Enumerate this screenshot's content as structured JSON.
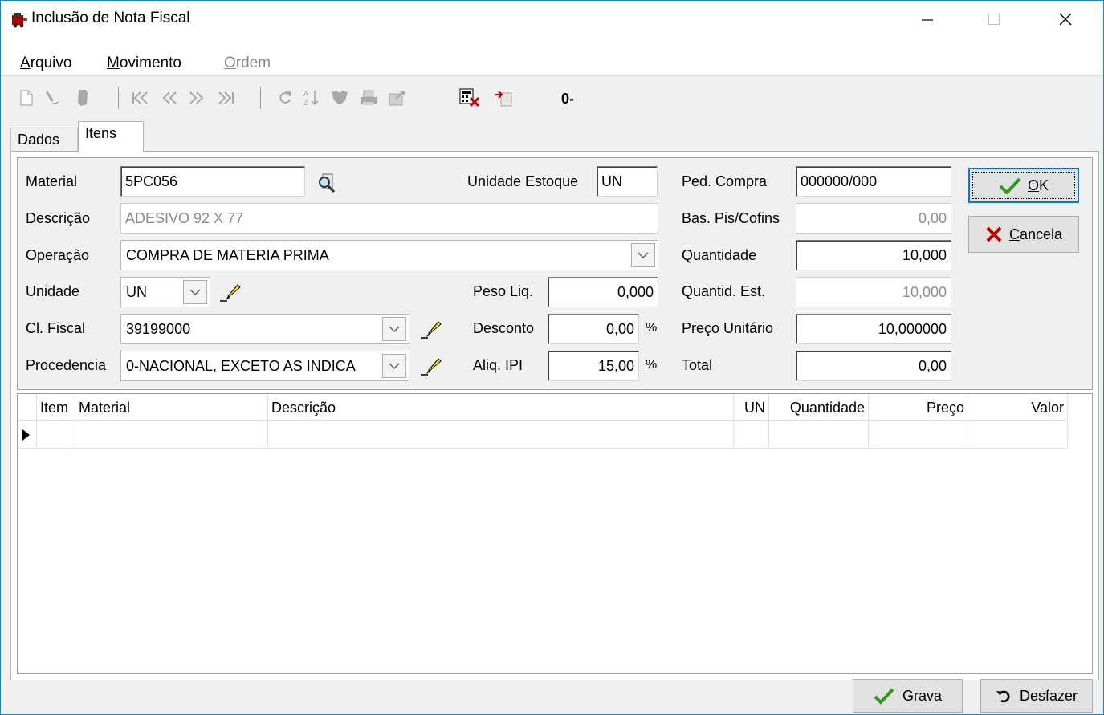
{
  "window": {
    "title": "Inclusão de Nota Fiscal",
    "controls": {
      "minimize": "—",
      "maximize": "☐",
      "close": "✕"
    }
  },
  "menu": {
    "items": [
      {
        "accel": "A",
        "rest": "rquivo",
        "enabled": true
      },
      {
        "accel": "M",
        "rest": "ovimento",
        "enabled": true
      },
      {
        "accel": "O",
        "rest": "rdem",
        "enabled": false
      }
    ]
  },
  "toolbar": {
    "record_counter": "0-",
    "icons": [
      "new-doc-icon",
      "edit-icon",
      "delete-icon",
      "first-record-icon",
      "prev-record-icon",
      "next-record-icon",
      "last-record-icon",
      "refresh-icon",
      "sort-icon",
      "filter-icon",
      "print-icon",
      "export-icon",
      "calculator-icon",
      "import-icon"
    ]
  },
  "tabs": [
    {
      "label": "Dados",
      "active": false
    },
    {
      "label": "Itens",
      "active": true
    }
  ],
  "form": {
    "material": {
      "label": "Material",
      "value": "5PC056"
    },
    "descricao": {
      "label": "Descrição",
      "value": "ADESIVO 92 X 77"
    },
    "operacao": {
      "label": "Operação",
      "value": "COMPRA DE MATERIA PRIMA"
    },
    "unidade": {
      "label": "Unidade",
      "value": "UN"
    },
    "cl_fiscal": {
      "label": "Cl. Fiscal",
      "value": "39199000"
    },
    "procedencia": {
      "label": "Procedencia",
      "value": "0-NACIONAL, EXCETO AS INDICA"
    },
    "unidade_estoque": {
      "label": "Unidade Estoque",
      "value": "UN"
    },
    "peso_liq": {
      "label": "Peso Liq.",
      "value": "0,000"
    },
    "desconto": {
      "label": "Desconto",
      "value": "0,00",
      "unit": "%"
    },
    "aliq_ipi": {
      "label": "Aliq. IPI",
      "value": "15,00",
      "unit": "%"
    },
    "ped_compra": {
      "label": "Ped. Compra",
      "value": "000000/000"
    },
    "bas_pis_cofins": {
      "label": "Bas. Pis/Cofins",
      "value": "0,00"
    },
    "quantidade": {
      "label": "Quantidade",
      "value": "10,000"
    },
    "quantid_est": {
      "label": "Quantid. Est.",
      "value": "10,000"
    },
    "preco_unitario": {
      "label": "Preço Unitário",
      "value": "10,000000"
    },
    "total": {
      "label": "Total",
      "value": "0,00"
    }
  },
  "buttons": {
    "ok": {
      "accel": "O",
      "rest": "K"
    },
    "cancela": {
      "accel": "C",
      "rest": "ancela"
    },
    "grava": "Grava",
    "desfazer": "Desfazer"
  },
  "grid": {
    "columns": [
      "Item",
      "Material",
      "Descrição",
      "UN",
      "Quantidade",
      "Preço",
      "Valor"
    ],
    "rows": []
  },
  "colors": {
    "accent": "#0078d7",
    "window_border": "#1883d7",
    "ok_check": "#2e9a1a",
    "cancel_x": "#c00000"
  }
}
